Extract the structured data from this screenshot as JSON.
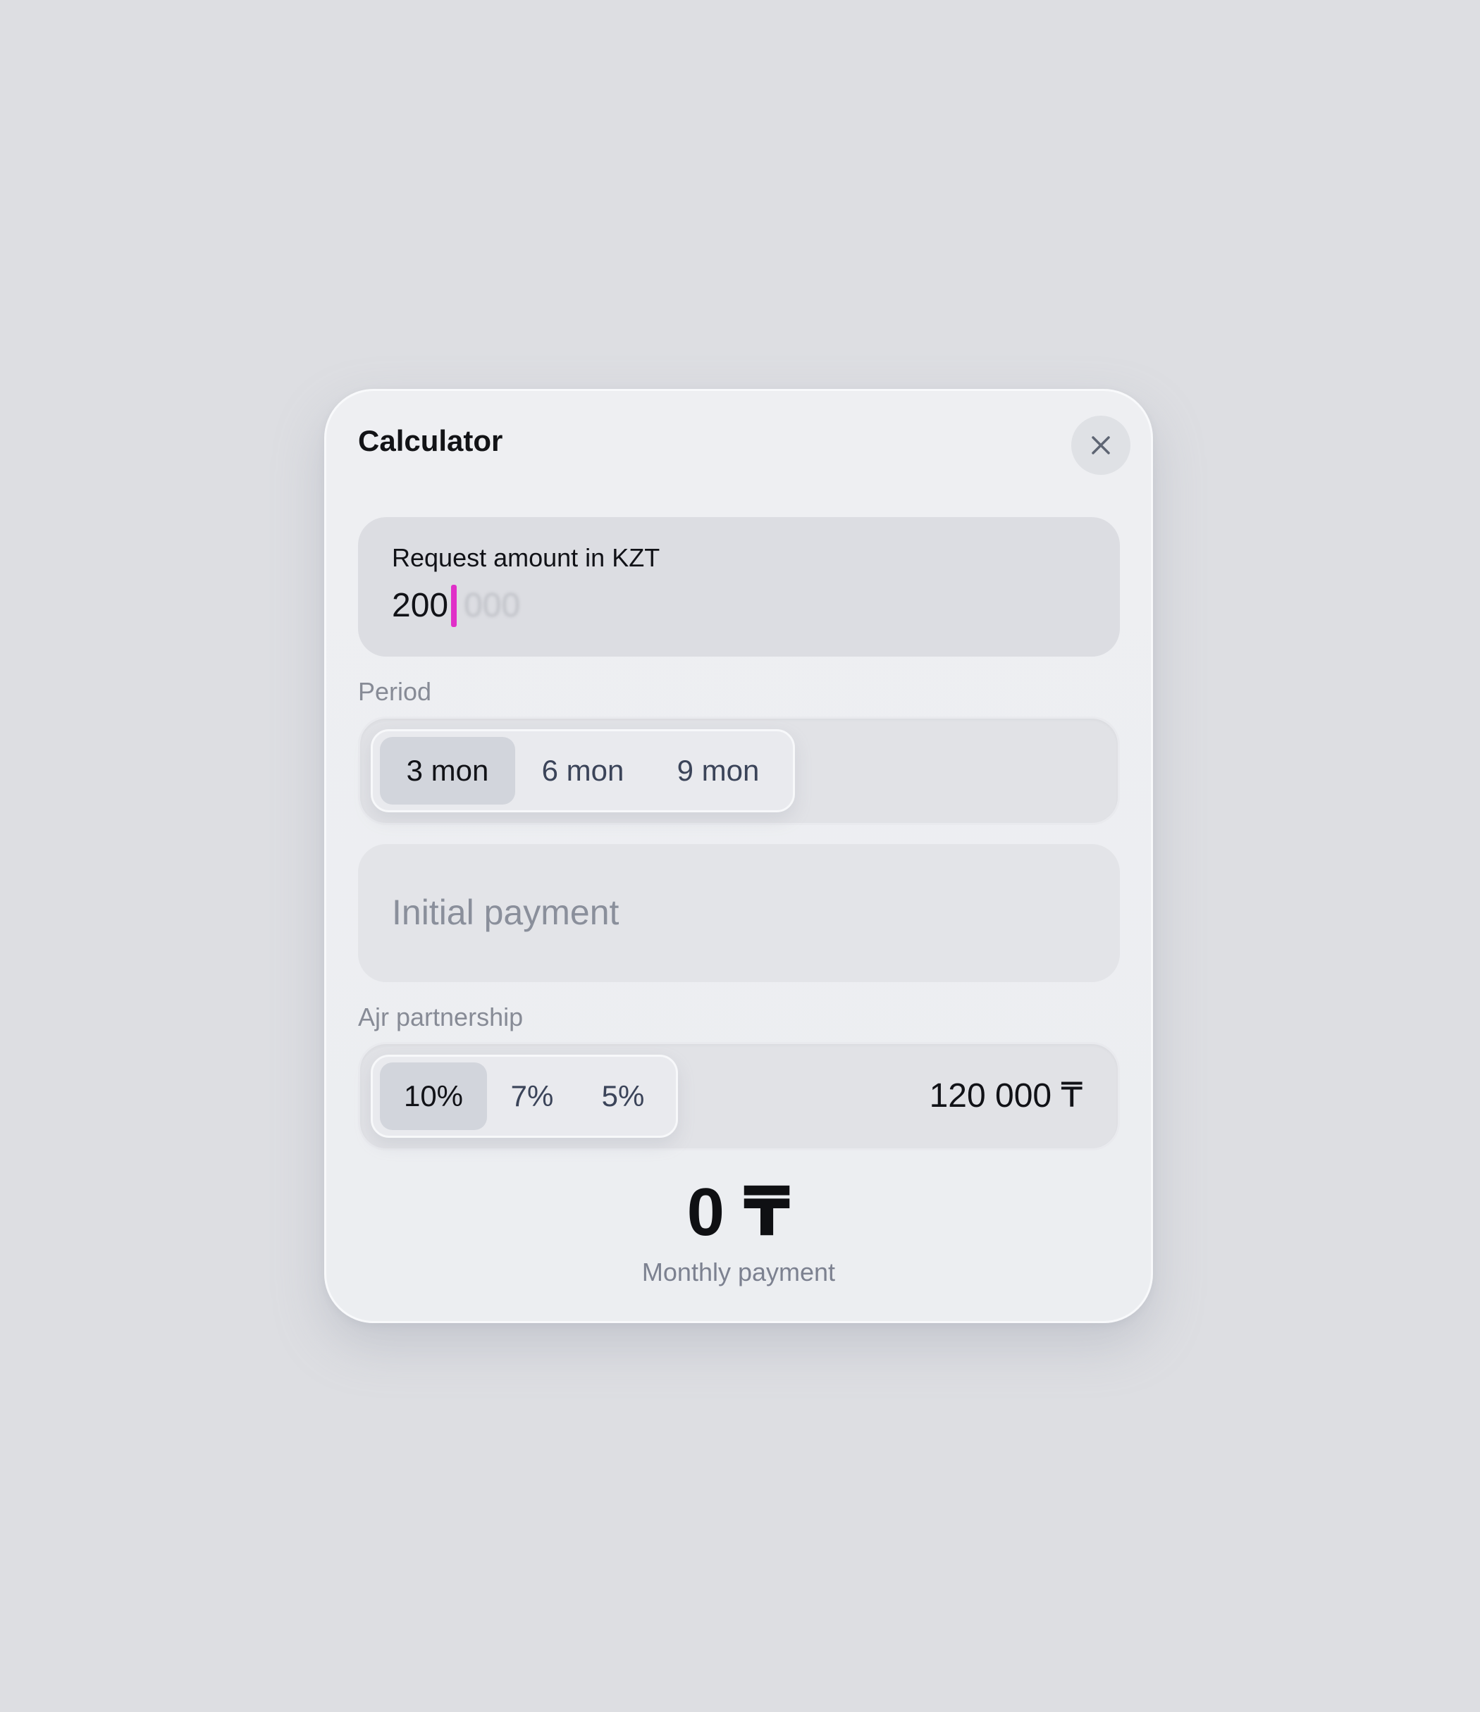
{
  "dialog": {
    "title": "Calculator",
    "close_icon": "close-icon"
  },
  "amount": {
    "label": "Request amount in KZT",
    "value": "200",
    "ghost_value": "000",
    "caret_color": "#e030c8"
  },
  "period": {
    "label": "Period",
    "options": [
      "3 mon",
      "6 mon",
      "9 mon"
    ],
    "selected": "3 mon"
  },
  "initial_payment": {
    "placeholder": "Initial payment"
  },
  "partnership": {
    "label": "Ajr partnership",
    "options": [
      "10%",
      "7%",
      "5%"
    ],
    "selected": "10%",
    "amount": "120 000 ₸"
  },
  "monthly": {
    "value": "0 ₸",
    "label": "Monthly payment"
  }
}
